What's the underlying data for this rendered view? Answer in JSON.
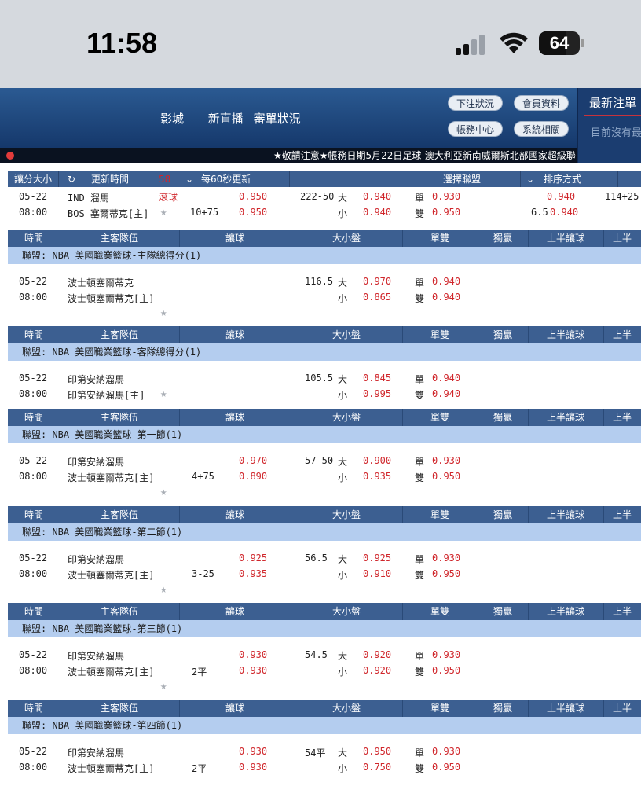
{
  "status": {
    "time": "11:58",
    "battery": "64"
  },
  "nav": {
    "links": [
      "影城",
      "新直播",
      "審單狀況"
    ],
    "buttons": [
      "下注狀況",
      "會員資料",
      "帳務中心",
      "系統相關"
    ],
    "latest_title": "最新注單",
    "latest_empty": "目前沒有最"
  },
  "ticker": "★敬請注意★帳務日期5月22日足球-澳大利亞新南威爾斯北部國家超級聯",
  "filter": {
    "size": "讓分大小",
    "refresh_label": "更新時間",
    "countdown": "58",
    "interval": "每60秒更新",
    "league_select": "選擇聯盟",
    "sort": "排序方式"
  },
  "columns": [
    "時間",
    "主客隊伍",
    "讓球",
    "大小盤",
    "單雙",
    "獨贏",
    "上半讓球",
    "上半"
  ],
  "top_game": {
    "date": "05-22",
    "time": "08:00",
    "team1": "IND 溜馬",
    "team2": "BOS 塞爾蒂克[主]",
    "live": "滾球",
    "hcap_line": "10+75",
    "hcap1": "0.950",
    "hcap2": "0.950",
    "ou_line": "222-50",
    "ou_big": "大",
    "ou_small": "小",
    "ou1": "0.940",
    "ou2": "0.940",
    "odd": "單",
    "even": "雙",
    "odd_val": "0.930",
    "even_val": "0.950",
    "h1": "0.940",
    "h1_line": "6.5",
    "h1_2": "0.940",
    "h2_line": "114+25"
  },
  "sections": [
    {
      "league": "聯盟: NBA 美國職業籃球-主隊總得分(1)",
      "date": "05-22",
      "time": "08:00",
      "team1": "波士頓塞爾蒂克",
      "team2": "波士頓塞爾蒂克[主]",
      "hcap_line": "",
      "hcap1": "",
      "hcap2": "",
      "ou_line": "116.5",
      "ou1": "0.970",
      "ou2": "0.865",
      "odd_val": "0.940",
      "even_val": "0.940",
      "star_row": 3
    },
    {
      "league": "聯盟: NBA 美國職業籃球-客隊總得分(1)",
      "date": "05-22",
      "time": "08:00",
      "team1": "印第安納溜馬",
      "team2": "印第安納溜馬[主]",
      "hcap_line": "",
      "hcap1": "",
      "hcap2": "",
      "ou_line": "105.5",
      "ou1": "0.845",
      "ou2": "0.995",
      "odd_val": "0.940",
      "even_val": "0.940",
      "star_row": 2
    },
    {
      "league": "聯盟: NBA 美國職業籃球-第一節(1)",
      "date": "05-22",
      "time": "08:00",
      "team1": "印第安納溜馬",
      "team2": "波士頓塞爾蒂克[主]",
      "hcap_line": "4+75",
      "hcap1": "0.970",
      "hcap2": "0.890",
      "ou_line": "57-50",
      "ou1": "0.900",
      "ou2": "0.935",
      "odd_val": "0.930",
      "even_val": "0.950",
      "star_row": 3
    },
    {
      "league": "聯盟: NBA 美國職業籃球-第二節(1)",
      "date": "05-22",
      "time": "08:00",
      "team1": "印第安納溜馬",
      "team2": "波士頓塞爾蒂克[主]",
      "hcap_line": "3-25",
      "hcap1": "0.925",
      "hcap2": "0.935",
      "ou_line": "56.5",
      "ou1": "0.925",
      "ou2": "0.910",
      "odd_val": "0.930",
      "even_val": "0.950",
      "star_row": 3
    },
    {
      "league": "聯盟: NBA 美國職業籃球-第三節(1)",
      "date": "05-22",
      "time": "08:00",
      "team1": "印第安納溜馬",
      "team2": "波士頓塞爾蒂克[主]",
      "hcap_line": "2平",
      "hcap1": "0.930",
      "hcap2": "0.930",
      "ou_line": "54.5",
      "ou1": "0.920",
      "ou2": "0.920",
      "odd_val": "0.930",
      "even_val": "0.950",
      "star_row": 3
    },
    {
      "league": "聯盟: NBA 美國職業籃球-第四節(1)",
      "date": "05-22",
      "time": "08:00",
      "team1": "印第安納溜馬",
      "team2": "波士頓塞爾蒂克[主]",
      "hcap_line": "2平",
      "hcap1": "0.930",
      "hcap2": "0.930",
      "ou_line": "54平",
      "ou1": "0.950",
      "ou2": "0.750",
      "odd_val": "0.930",
      "even_val": "0.950",
      "star_row": 0
    }
  ],
  "labels": {
    "big": "大",
    "small": "小",
    "odd": "單",
    "even": "雙",
    "star": "★"
  }
}
